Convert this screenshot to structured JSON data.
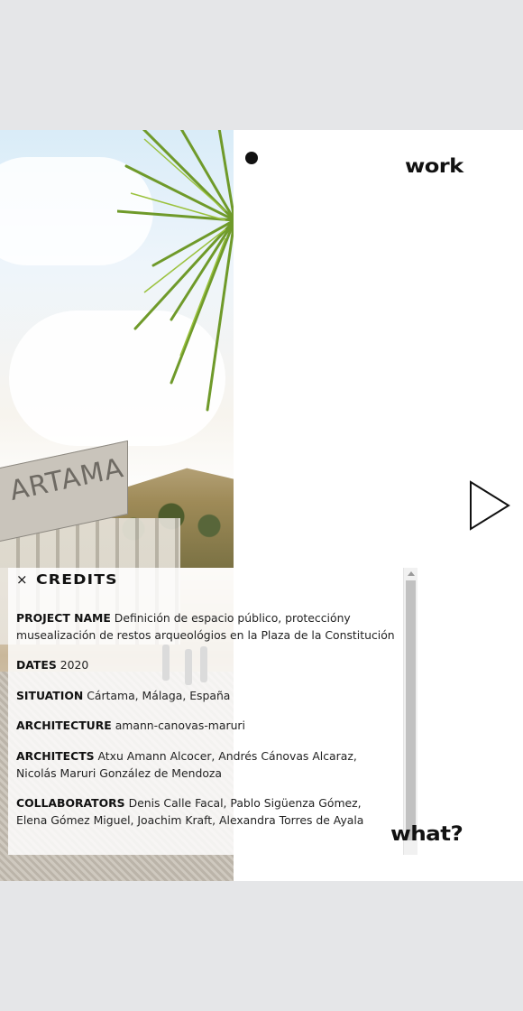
{
  "nav": {
    "work_label": "work",
    "what_label": "what?",
    "next_icon": "play-triangle-outline-icon",
    "dot_icon": "filled-circle-icon"
  },
  "photo": {
    "sign_text": "ARTAMA"
  },
  "credits": {
    "close_icon": "close-x",
    "close_glyph": "×",
    "title": "CREDITS",
    "rows": [
      {
        "label": "PROJECT NAME",
        "value": "Definición de espacio público, proteccióny musealización de restos arqueológios en la Plaza de la Constitución"
      },
      {
        "label": "DATES",
        "value": "2020"
      },
      {
        "label": "SITUATION",
        "value": "Cártama, Málaga, España"
      },
      {
        "label": "ARCHITECTURE",
        "value": "amann-canovas-maruri"
      },
      {
        "label": "ARCHITECTS",
        "value": "Atxu Amann Alcocer, Andrés Cánovas Alcaraz, Nicolás Maruri González de Mendoza"
      },
      {
        "label": "COLLABORATORS",
        "value": "Denis Calle Facal, Pablo Sigüenza Gómez, Elena Gómez Miguel, Joachim Kraft, Alexandra Torres de Ayala"
      }
    ]
  },
  "colors": {
    "page_background": "#e5e6e8",
    "frame_background": "#ffffff",
    "text": "#111111"
  }
}
